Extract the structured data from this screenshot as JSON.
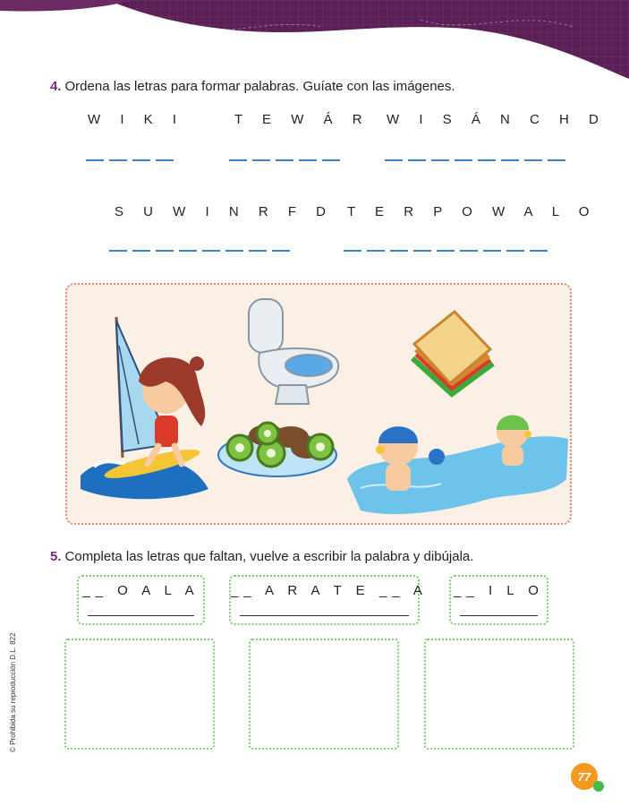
{
  "exercise4": {
    "number": "4.",
    "instruction": "Ordena las letras para formar palabras. Guíate con las imágenes.",
    "words": [
      {
        "scrambled": "W I K I",
        "blanks": 4
      },
      {
        "scrambled": "T E W Á R",
        "blanks": 5
      },
      {
        "scrambled": "W I S Á N C H D",
        "blanks": 8
      },
      {
        "scrambled": "S U W I N R F D",
        "blanks": 8
      },
      {
        "scrambled": "T E R P O W A L O",
        "blanks": 9
      }
    ]
  },
  "exercise5": {
    "number": "5.",
    "instruction": "Completa las letras que faltan, vuelve a escribir la palabra y dibújala.",
    "items": [
      {
        "letters": "__ O A L A"
      },
      {
        "letters": "__ A R A T E __ A"
      },
      {
        "letters": "__ I L O"
      }
    ]
  },
  "footer": {
    "copyright": "© Prohibida su reproducción D.L. 822",
    "page_number": "77"
  },
  "colors": {
    "banner": "#5a1f55",
    "accent_purple": "#7a2a7e",
    "blank_blue": "#3a86c8",
    "box_border_green": "#7bcf6e",
    "picture_border": "#e58a7a",
    "picture_bg": "#fbf0e6",
    "page_orange": "#f39a1e",
    "page_green": "#47b84a"
  },
  "icons": [
    "sailboat-girl-icon",
    "toilet-icon",
    "kiwi-plate-icon",
    "sandwich-icon",
    "swimming-kids-icon"
  ]
}
